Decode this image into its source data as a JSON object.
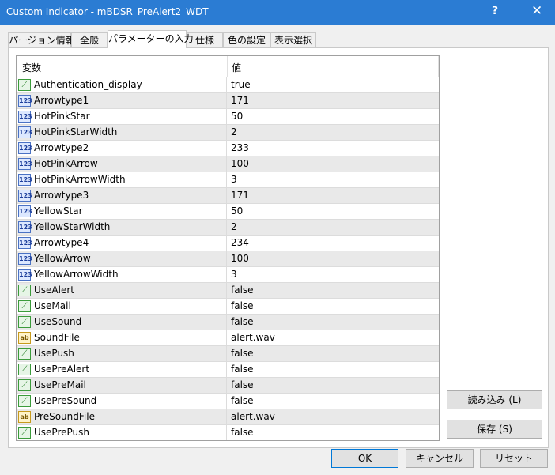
{
  "window": {
    "title": "Custom Indicator - mBDSR_PreAlert2_WDT",
    "help": "?",
    "close": "✕"
  },
  "tabs": [
    {
      "label": "パージョン情報"
    },
    {
      "label": "全般"
    },
    {
      "label": "パラメーターの入力"
    },
    {
      "label": "仕様"
    },
    {
      "label": "色の設定"
    },
    {
      "label": "表示選択"
    }
  ],
  "grid": {
    "col_name": "変数",
    "col_value": "値",
    "rows": [
      {
        "type": "bool",
        "name": "Authentication_display",
        "value": "true"
      },
      {
        "type": "int",
        "name": "Arrowtype1",
        "value": "171"
      },
      {
        "type": "int",
        "name": "HotPinkStar",
        "value": "50"
      },
      {
        "type": "int",
        "name": "HotPinkStarWidth",
        "value": "2"
      },
      {
        "type": "int",
        "name": "Arrowtype2",
        "value": "233"
      },
      {
        "type": "int",
        "name": "HotPinkArrow",
        "value": "100"
      },
      {
        "type": "int",
        "name": "HotPinkArrowWidth",
        "value": "3"
      },
      {
        "type": "int",
        "name": "Arrowtype3",
        "value": "171"
      },
      {
        "type": "int",
        "name": "YellowStar",
        "value": "50"
      },
      {
        "type": "int",
        "name": "YellowStarWidth",
        "value": "2"
      },
      {
        "type": "int",
        "name": "Arrowtype4",
        "value": "234"
      },
      {
        "type": "int",
        "name": "YellowArrow",
        "value": "100"
      },
      {
        "type": "int",
        "name": "YellowArrowWidth",
        "value": "3"
      },
      {
        "type": "bool",
        "name": "UseAlert",
        "value": "false"
      },
      {
        "type": "bool",
        "name": "UseMail",
        "value": "false"
      },
      {
        "type": "bool",
        "name": "UseSound",
        "value": "false"
      },
      {
        "type": "str",
        "name": "SoundFile",
        "value": "alert.wav"
      },
      {
        "type": "bool",
        "name": "UsePush",
        "value": "false"
      },
      {
        "type": "bool",
        "name": "UsePreAlert",
        "value": "false"
      },
      {
        "type": "bool",
        "name": "UsePreMail",
        "value": "false"
      },
      {
        "type": "bool",
        "name": "UsePreSound",
        "value": "false"
      },
      {
        "type": "str",
        "name": "PreSoundFile",
        "value": "alert.wav"
      },
      {
        "type": "bool",
        "name": "UsePrePush",
        "value": "false"
      }
    ]
  },
  "icons": {
    "bool": "bool-icon",
    "int": "int-icon",
    "str": "string-icon"
  },
  "icon_glyphs": {
    "bool": "⟋",
    "int": "123",
    "str": "ab"
  },
  "buttons": {
    "load": "読み込み (L)",
    "save": "保存 (S)",
    "ok": "OK",
    "cancel": "キャンセル",
    "reset": "リセット"
  },
  "colors": {
    "titlebar": "#2b7cd3",
    "ok_border": "#0078d7"
  }
}
